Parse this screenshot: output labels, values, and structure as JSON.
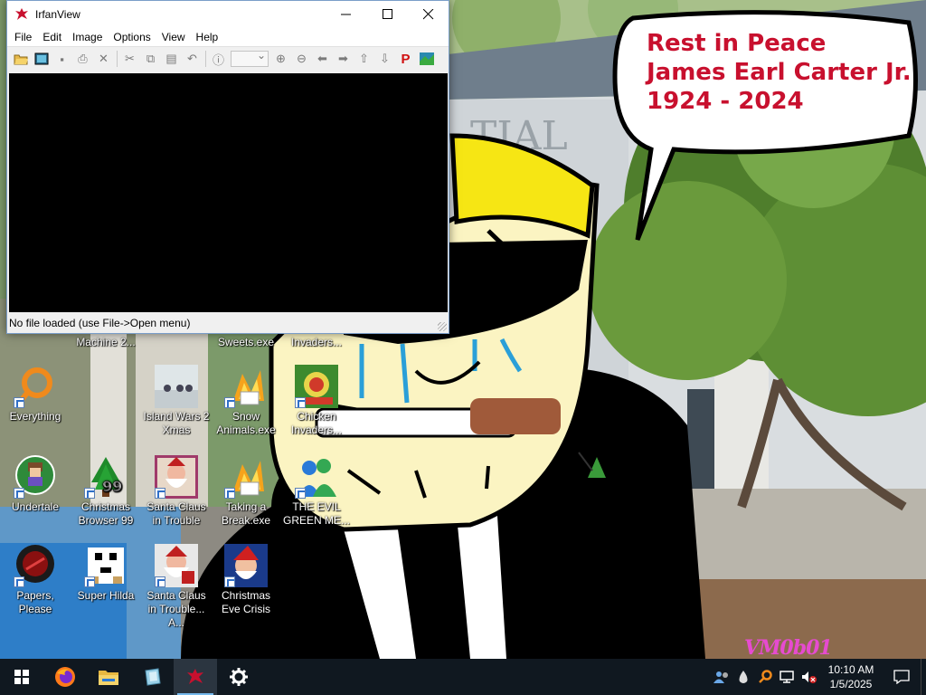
{
  "window": {
    "title": "IrfanView",
    "menu": [
      "File",
      "Edit",
      "Image",
      "Options",
      "View",
      "Help"
    ],
    "status": "No file loaded (use File->Open menu)",
    "toolbar_icons": [
      "open-folder-icon",
      "slideshow-icon",
      "save-icon",
      "print-icon",
      "delete-icon",
      "cut-icon",
      "copy-icon",
      "paste-icon",
      "undo-icon",
      "info-icon",
      "zoom-combo",
      "zoom-in-icon",
      "zoom-out-icon",
      "previous-icon",
      "next-icon",
      "first-icon",
      "last-icon",
      "paint-icon",
      "irfan-logo-icon"
    ]
  },
  "wallpaper": {
    "speech_lines": [
      "Rest in Peace",
      "James Earl Carter Jr.",
      "1924 - 2024"
    ],
    "signature": "VM0b01",
    "sign_text": "TIAL"
  },
  "desktop": {
    "partial_labels": [
      "Machine 2...",
      "Sweets.exe",
      "Invaders..."
    ],
    "icons": [
      {
        "label": "Everything",
        "icon": "everything-icon"
      },
      {
        "label": "Island Wars 2 Xmas",
        "icon": "island-wars-icon"
      },
      {
        "label": "Snow Animals.exe",
        "icon": "snow-animals-icon"
      },
      {
        "label": "Chicken Invaders...",
        "icon": "chicken-invaders-icon"
      },
      {
        "label": "Undertale",
        "icon": "undertale-icon"
      },
      {
        "label": "Christmas Browser 99",
        "icon": "christmas-browser-icon",
        "badge": "99"
      },
      {
        "label": "Santa Claus in Trouble",
        "icon": "santa-trouble-icon"
      },
      {
        "label": "Taking a Break.exe",
        "icon": "taking-break-icon"
      },
      {
        "label": "THE EVIL GREEN ME...",
        "icon": "evil-green-icon"
      },
      {
        "label": "Papers, Please",
        "icon": "papers-please-icon"
      },
      {
        "label": "Super Hilda",
        "icon": "super-hilda-icon"
      },
      {
        "label": "Santa Claus in Trouble... A...",
        "icon": "santa-trouble-2-icon"
      },
      {
        "label": "Christmas Eve Crisis",
        "icon": "christmas-eve-icon"
      }
    ]
  },
  "taskbar": {
    "items": [
      "start-icon",
      "firefox-icon",
      "file-explorer-icon",
      "app-icon",
      "irfanview-icon",
      "settings-icon"
    ],
    "time": "10:10 AM",
    "date": "1/5/2025"
  },
  "colors": {
    "speech_text": "#c8102e",
    "taskbar": "#101820",
    "accent": "#76b9ed"
  }
}
